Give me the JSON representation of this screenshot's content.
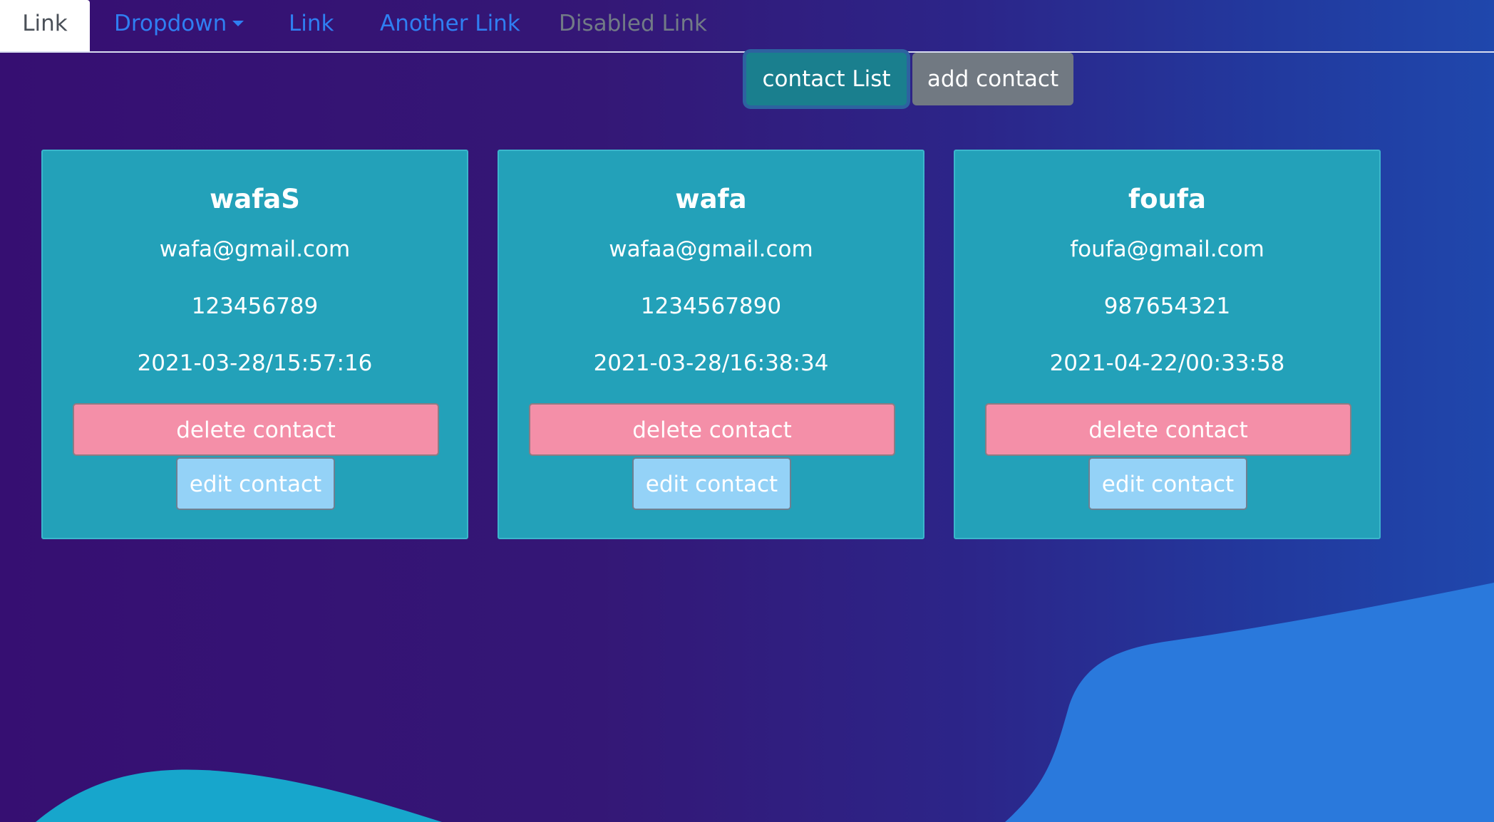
{
  "nav": {
    "items": [
      {
        "label": "Link",
        "state": "active"
      },
      {
        "label": "Dropdown",
        "state": "dropdown"
      },
      {
        "label": "Link",
        "state": "normal"
      },
      {
        "label": "Another Link",
        "state": "normal"
      },
      {
        "label": "Disabled Link",
        "state": "disabled"
      }
    ]
  },
  "toolbar": {
    "contact_list_label": "contact List",
    "add_contact_label": "add contact"
  },
  "contacts": [
    {
      "name": "wafaS",
      "email": "wafa@gmail.com",
      "phone": "123456789",
      "date": "2021-03-28/15:57:16",
      "delete_label": "delete contact",
      "edit_label": "edit contact"
    },
    {
      "name": "wafa",
      "email": "wafaa@gmail.com",
      "phone": "1234567890",
      "date": "2021-03-28/16:38:34",
      "delete_label": "delete contact",
      "edit_label": "edit contact"
    },
    {
      "name": "foufa",
      "email": "foufa@gmail.com",
      "phone": "987654321",
      "date": "2021-04-22/00:33:58",
      "delete_label": "delete contact",
      "edit_label": "edit contact"
    }
  ],
  "colors": {
    "background_start": "#360f72",
    "background_end": "#1f47ac",
    "card": "#23a1b9",
    "delete_button": "#f48fa8",
    "edit_button": "#94d2f7",
    "contact_list_button": "#1a7f8e",
    "add_contact_button": "#717982",
    "nav_link": "#2f7ff2",
    "nav_disabled": "#727b86"
  }
}
